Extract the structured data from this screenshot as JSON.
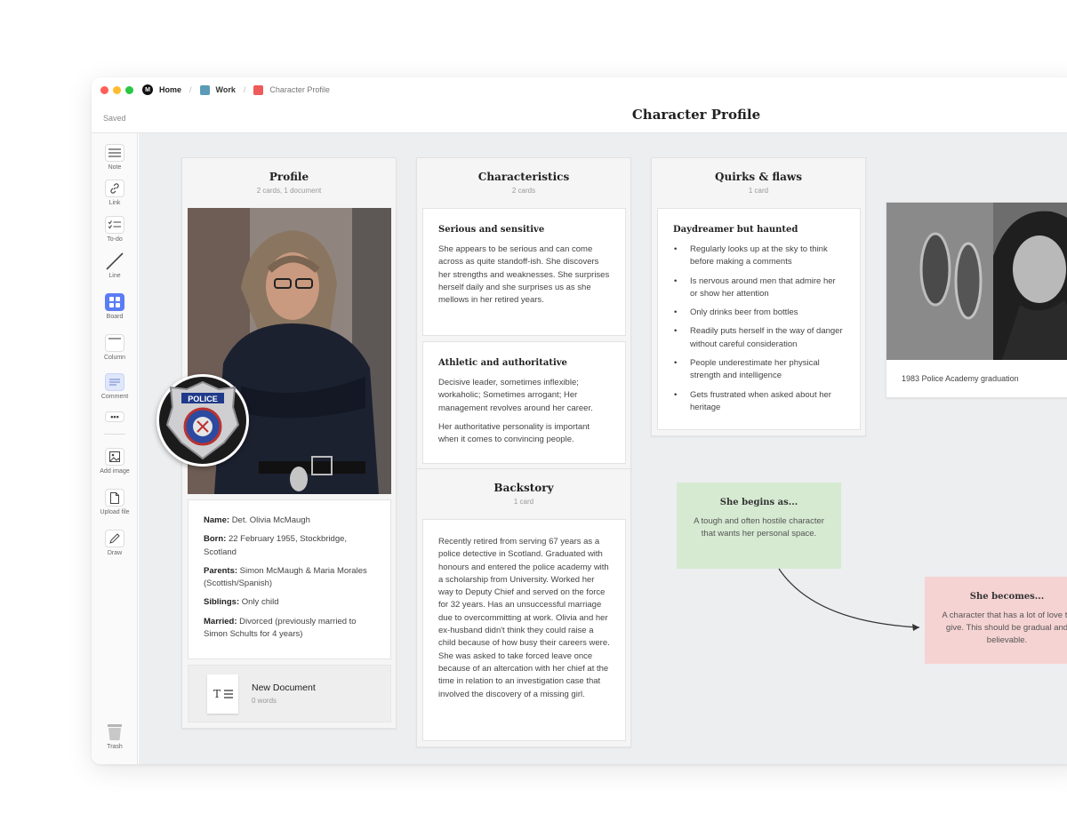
{
  "window": {
    "breadcrumbs": [
      {
        "label": "Home",
        "icon": "milanote-logo-icon"
      },
      {
        "label": "Work",
        "color": "#5b9bb8"
      },
      {
        "label": "Character Profile",
        "color": "#ef5a5a"
      }
    ],
    "status": "Saved",
    "title": "Character Profile"
  },
  "toolbar": {
    "items": [
      {
        "label": "Note",
        "icon": "note-icon"
      },
      {
        "label": "Link",
        "icon": "link-icon"
      },
      {
        "label": "To-do",
        "icon": "todo-icon"
      },
      {
        "label": "Line",
        "icon": "line-icon"
      },
      {
        "label": "Board",
        "icon": "board-icon"
      },
      {
        "label": "Column",
        "icon": "column-icon"
      },
      {
        "label": "Comment",
        "icon": "comment-icon"
      },
      {
        "label": "",
        "icon": "more-icon"
      },
      {
        "label": "Add image",
        "icon": "image-icon"
      },
      {
        "label": "Upload file",
        "icon": "file-icon"
      },
      {
        "label": "Draw",
        "icon": "pen-icon"
      },
      {
        "label": "Trash",
        "icon": "trash-icon"
      }
    ]
  },
  "profile": {
    "title": "Profile",
    "subtitle": "2 cards, 1 document",
    "badge_text": "POLICE",
    "facts": [
      {
        "label": "Name:",
        "value": "Det. Olivia McMaugh"
      },
      {
        "label": "Born:",
        "value": "22 February 1955, Stockbridge, Scotland"
      },
      {
        "label": "Parents:",
        "value": "Simon McMaugh & Maria Morales (Scottish/Spanish)"
      },
      {
        "label": "Siblings:",
        "value": "Only child"
      },
      {
        "label": "Married:",
        "value": "Divorced (previously married to Simon Schults for 4 years)"
      }
    ],
    "document": {
      "title": "New Document",
      "meta": "0 words"
    }
  },
  "characteristics": {
    "title": "Characteristics",
    "subtitle": "2 cards",
    "cards": [
      {
        "heading": "Serious and sensitive",
        "paragraphs": [
          "She appears to be serious and can come across as quite standoff-ish. She discovers her strengths and weaknesses. She surprises herself daily and she surprises us as she mellows in her retired years."
        ]
      },
      {
        "heading": "Athletic and authoritative",
        "paragraphs": [
          "Decisive leader, sometimes inflexible; workaholic; Sometimes arrogant; Her management revolves around her career.",
          "Her authoritative personality is important when it comes to convincing people."
        ]
      }
    ]
  },
  "backstory": {
    "title": "Backstory",
    "subtitle": "1 card",
    "text": "Recently retired from serving 67 years as a police detective in Scotland. Graduated with honours and entered the police academy with a scholarship from University. Worked her way to Deputy Chief and served on the force for 32 years. Has an unsuccessful marriage due to overcommitting at work. Olivia and her ex-husband didn't think they could raise a child because of how busy their careers were. She was asked to take forced leave once because of an altercation with her chief at the time in relation to an investigation case that involved the discovery of a missing girl."
  },
  "quirks": {
    "title": "Quirks & flaws",
    "subtitle": "1 card",
    "heading": "Daydreamer but haunted",
    "items": [
      "Regularly looks up at the sky to think before making a comments",
      "Is nervous around men that admire her or show her attention",
      "Only drinks beer from bottles",
      "Readily puts herself in the way of danger without careful consideration",
      "People underestimate her physical strength and intelligence",
      "Gets frustrated when asked about her heritage"
    ]
  },
  "photo_card": {
    "caption": "1983 Police Academy graduation"
  },
  "notes": {
    "begins": {
      "heading": "She begins as...",
      "text": "A tough and often hostile character that wants her personal space.",
      "color": "#d6ead2"
    },
    "becomes": {
      "heading": "She becomes...",
      "text": "A character that has a lot of love to give. This should be gradual and believable.",
      "color": "#f6d3d3"
    }
  }
}
